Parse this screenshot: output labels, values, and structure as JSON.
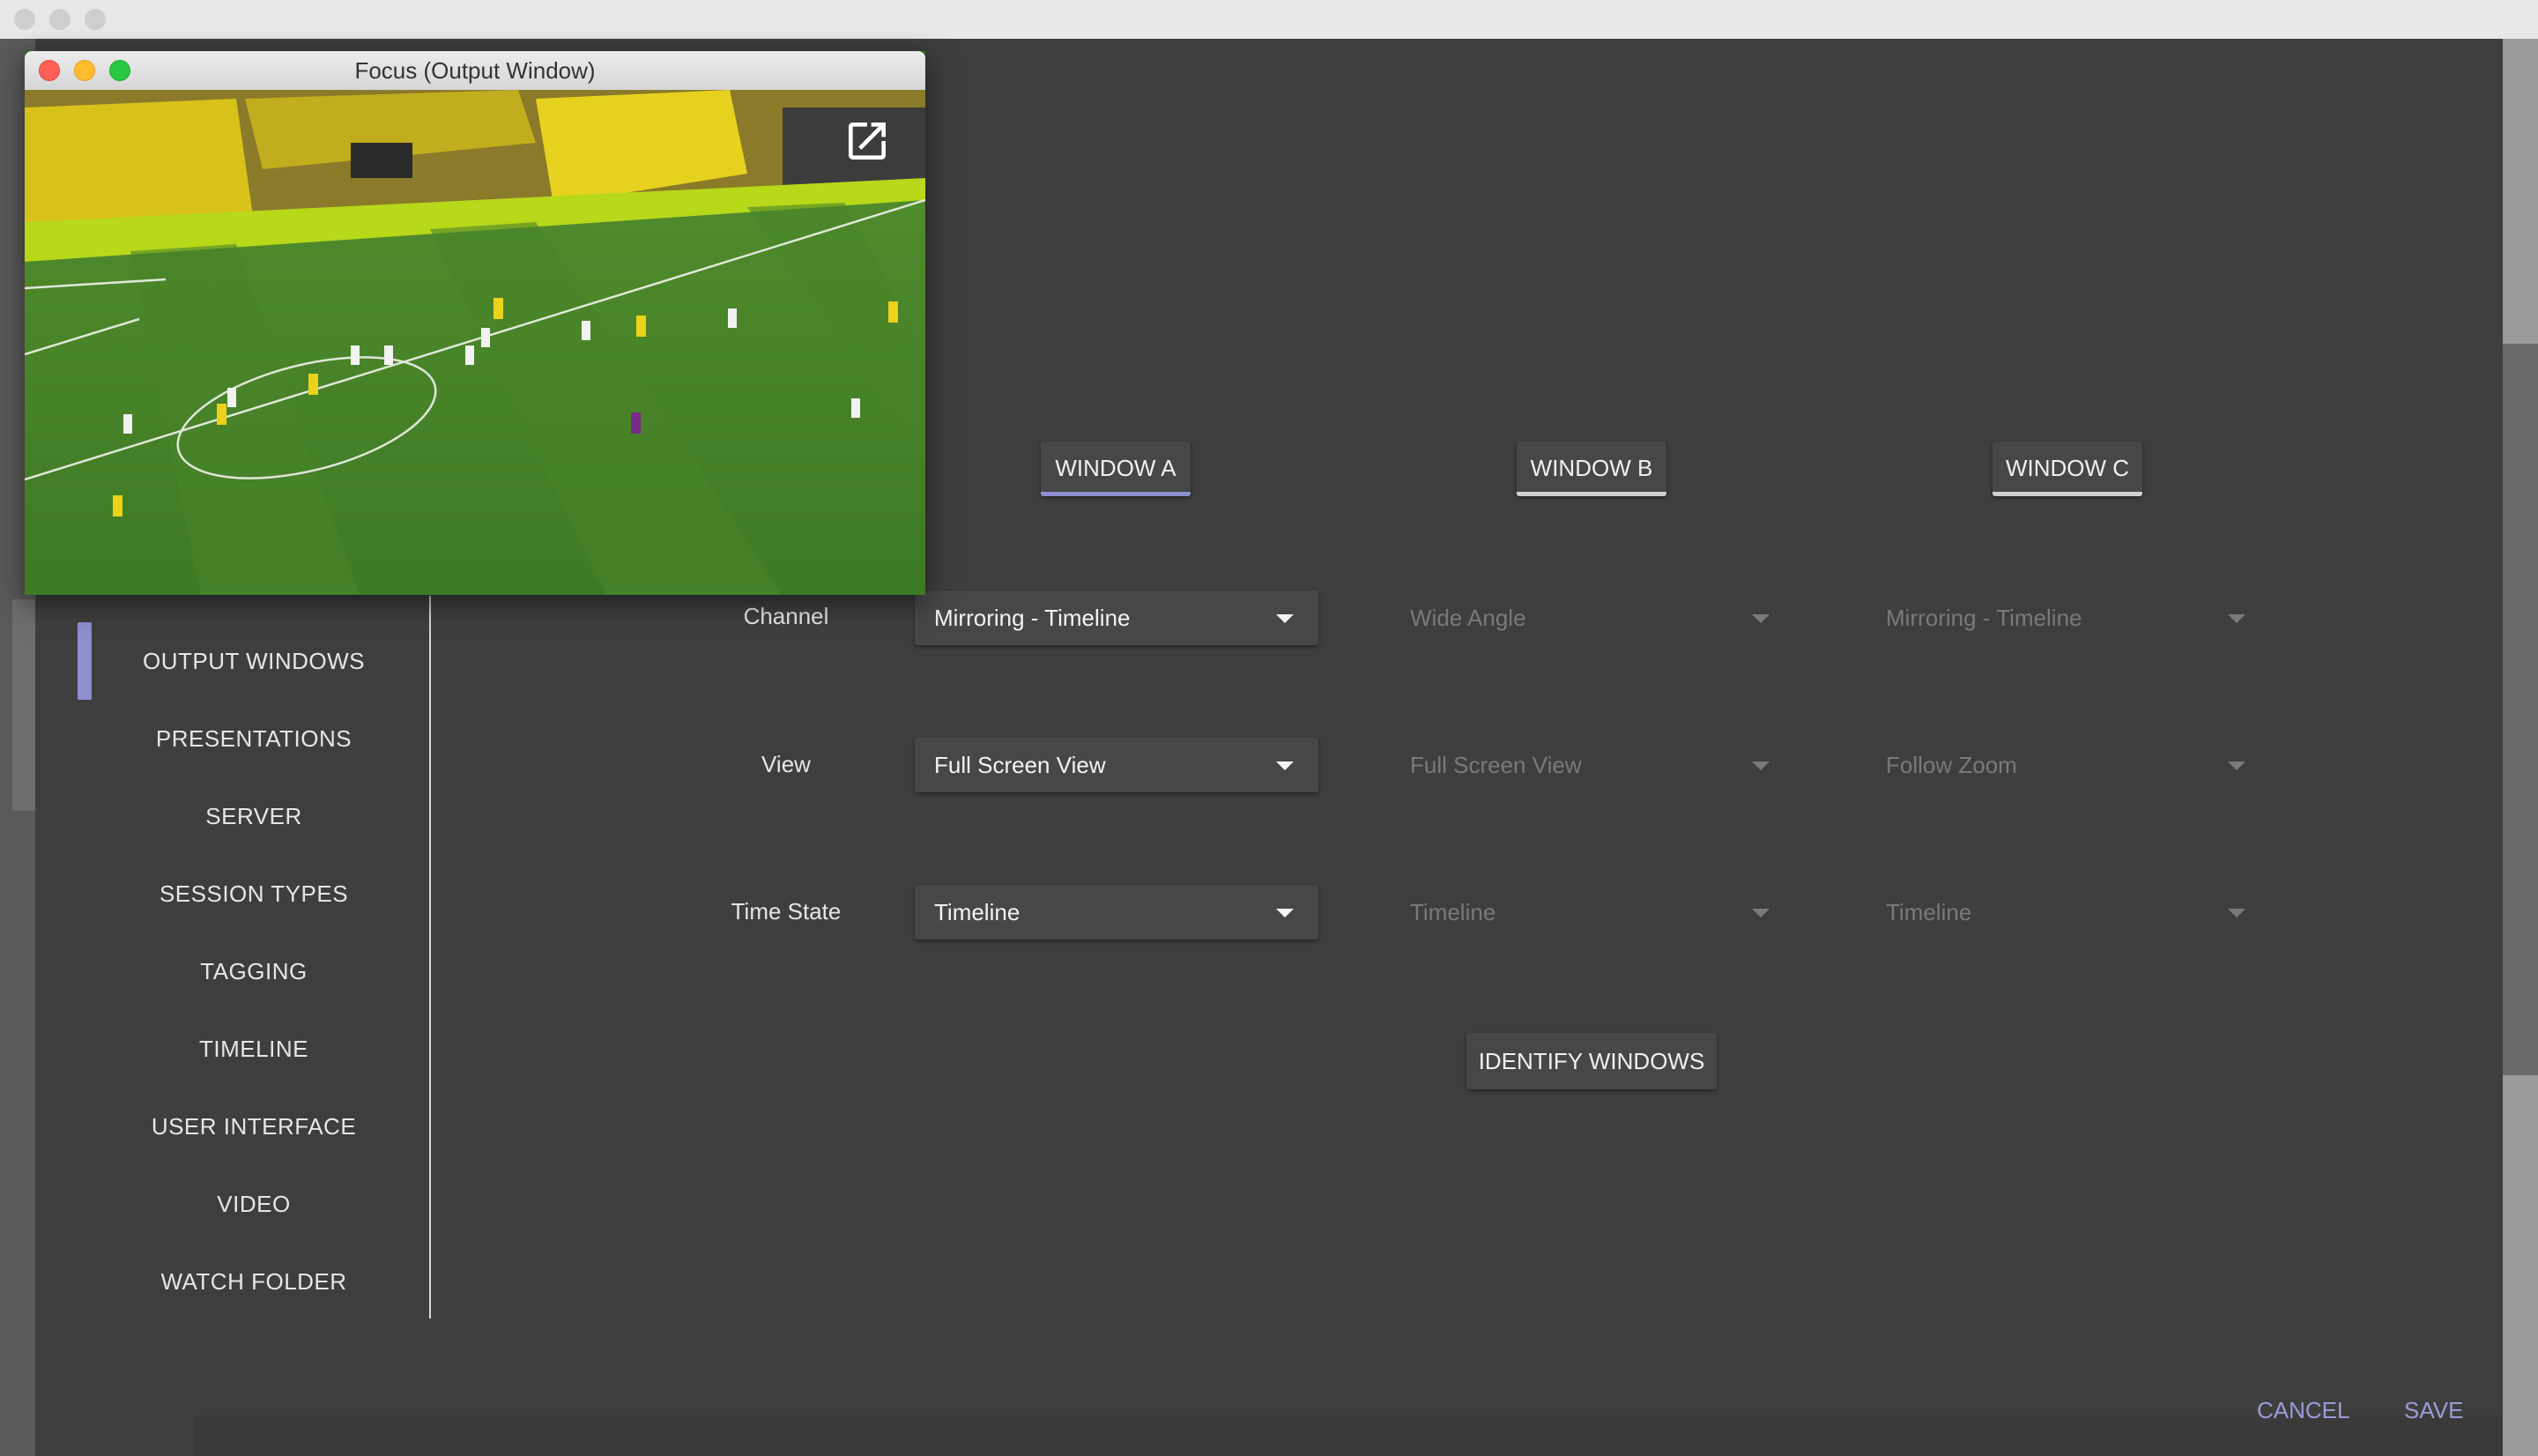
{
  "floating_window": {
    "title": "Focus (Output Window)",
    "popout_icon": "open-in-new-icon"
  },
  "nav": {
    "items": [
      {
        "label": "OUTPUT WINDOWS",
        "selected": true
      },
      {
        "label": "PRESENTATIONS"
      },
      {
        "label": "SERVER"
      },
      {
        "label": "SESSION TYPES"
      },
      {
        "label": "TAGGING"
      },
      {
        "label": "TIMELINE"
      },
      {
        "label": "USER INTERFACE"
      },
      {
        "label": "VIDEO"
      },
      {
        "label": "WATCH FOLDER"
      }
    ]
  },
  "windows": {
    "tabs": [
      {
        "label": "WINDOW A",
        "active": true
      },
      {
        "label": "WINDOW B"
      },
      {
        "label": "WINDOW C"
      }
    ]
  },
  "rows": {
    "channel": {
      "label": "Channel",
      "values": [
        "Mirroring - Timeline",
        "Wide Angle",
        "Mirroring - Timeline"
      ]
    },
    "view": {
      "label": "View",
      "values": [
        "Full Screen View",
        "Full Screen View",
        "Follow Zoom"
      ]
    },
    "time_state": {
      "label": "Time State",
      "values": [
        "Timeline",
        "Timeline",
        "Timeline"
      ]
    }
  },
  "actions": {
    "identify": "IDENTIFY WINDOWS",
    "cancel": "CANCEL",
    "save": "SAVE"
  },
  "colors": {
    "accent": "#8c8fd0",
    "background": "#3e3e3e",
    "control": "#474747"
  }
}
